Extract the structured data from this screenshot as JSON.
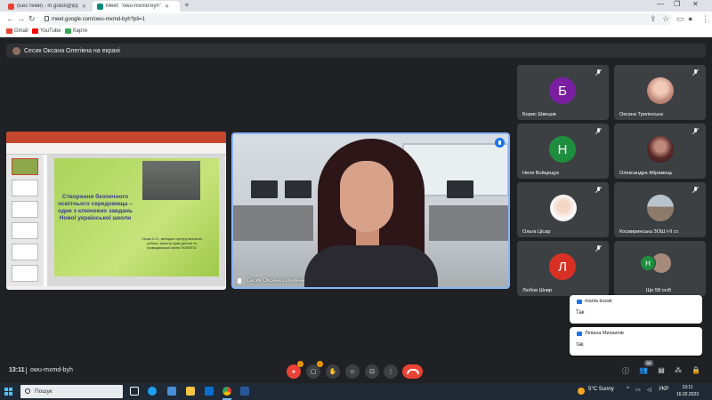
{
  "browser": {
    "tabs": [
      {
        "label": "(Без теми) - m.golub@ippo.edu...",
        "icon": "gmail-icon",
        "active": false
      },
      {
        "label": "Meet: \"owu-mxmd-byh\"",
        "icon": "meet-icon",
        "active": true
      }
    ],
    "url": "meet.google.com/owu-mxmd-byh?pli=1",
    "bookmarks": [
      {
        "label": "Gmail",
        "icon": "gmail-icon"
      },
      {
        "label": "YouTube",
        "icon": "youtube-icon"
      },
      {
        "label": "Карти",
        "icon": "maps-icon"
      }
    ]
  },
  "meet": {
    "presenting_banner": "Сесик Оксана Олегівна на екрані",
    "presentation": {
      "slide_title": "Створення безпечного освітнього середовища – одне з ключових завдань Нової української школи",
      "slide_caption": "Сесик О.О., методист центру виховної роботи, захисту прав дитини та громадянської освіти ПОКІППО"
    },
    "speaker": {
      "name": "Сесик Оксана Олегівна"
    },
    "participants": [
      {
        "name": "Борис Швецов",
        "initial": "Б",
        "color": "#7b1fa2",
        "type": "initial"
      },
      {
        "name": "Оксана Трилінська",
        "initial": "",
        "color": "#d8b4a4",
        "type": "photo"
      },
      {
        "name": "Неля Войцещук",
        "initial": "Н",
        "color": "#1e8e3e",
        "type": "initial"
      },
      {
        "name": "Олександра Абрамець",
        "initial": "",
        "color": "#5b2a2a",
        "type": "photo"
      },
      {
        "name": "Ольга Цісар",
        "initial": "",
        "color": "#e7e7e7",
        "type": "photo"
      },
      {
        "name": "Космиринська ЗОШ І-ІІ ст.",
        "initial": "",
        "color": "#8c7b6a",
        "type": "photo"
      },
      {
        "name": "Любов Шнир",
        "initial": "Л",
        "color": "#d93025",
        "type": "initial"
      },
      {
        "name": "Ще 58 осіб",
        "initial": "Н",
        "color": "#1e8e3e",
        "type": "more"
      }
    ],
    "chat_notifications": [
      {
        "sender": "mariia kozak",
        "message": "Так"
      },
      {
        "sender": "Лілiана Михаилів",
        "message": "так"
      }
    ],
    "bottom_bar": {
      "time": "13:11",
      "meeting_code": "owu-mxmd-byh",
      "participant_count": "68",
      "mic_badge": "!",
      "cam_badge": "!"
    }
  },
  "taskbar": {
    "search_placeholder": "Пошук",
    "weather": "5°C  Sunny",
    "language": "УКР",
    "time": "13:11",
    "date": "16.02.2023"
  }
}
